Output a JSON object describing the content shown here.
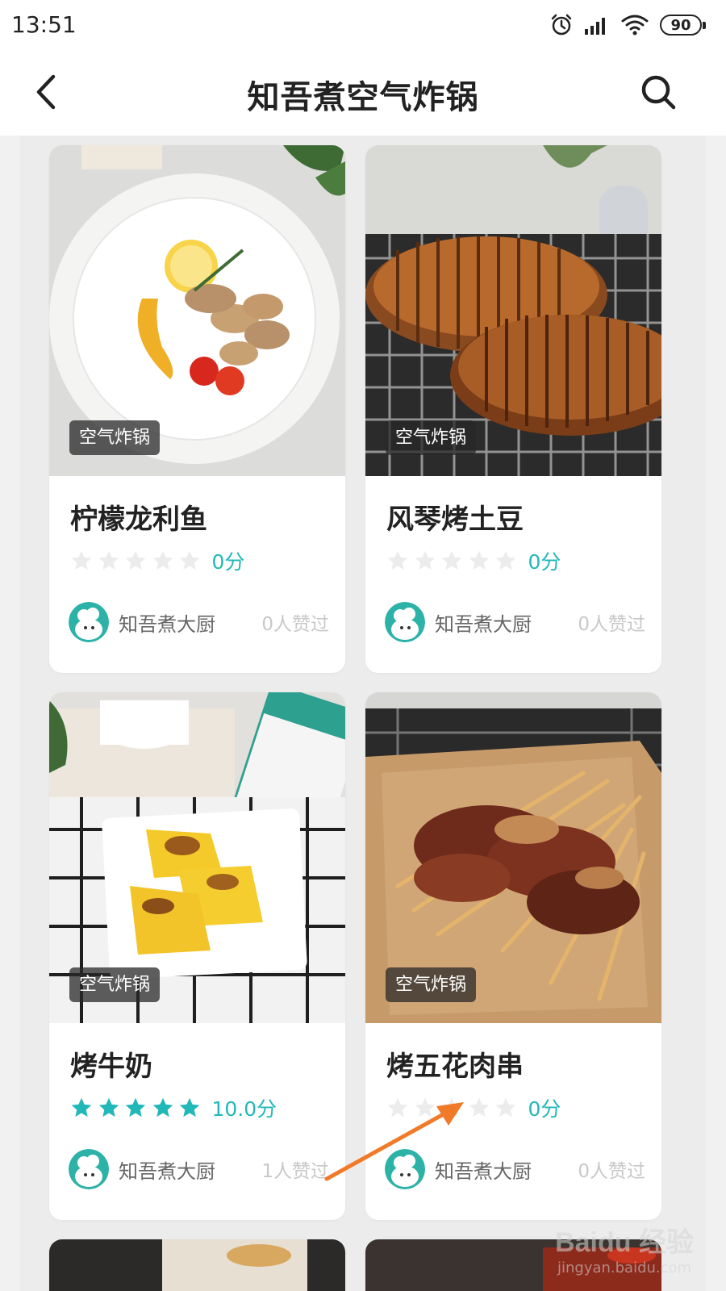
{
  "status_bar": {
    "time": "13:51",
    "battery": "90"
  },
  "header": {
    "title": "知吾煮空气炸锅"
  },
  "colors": {
    "accent": "#22b8b8",
    "star_empty": "#ececec",
    "tag_bg": "#3a3a3a"
  },
  "icons": {
    "back": "chevron-left-icon",
    "search": "search-icon",
    "alarm": "alarm-icon",
    "signal": "signal-icon",
    "wifi": "wifi-icon"
  },
  "cards": [
    {
      "tag": "空气炸锅",
      "title": "柠檬龙利鱼",
      "rating_stars": 0,
      "score": "0分",
      "author": "知吾煮大厨",
      "likes": "0人赞过"
    },
    {
      "tag": "空气炸锅",
      "title": "风琴烤土豆",
      "rating_stars": 0,
      "score": "0分",
      "author": "知吾煮大厨",
      "likes": "0人赞过"
    },
    {
      "tag": "空气炸锅",
      "title": "烤牛奶",
      "rating_stars": 5,
      "score": "10.0分",
      "author": "知吾煮大厨",
      "likes": "1人赞过"
    },
    {
      "tag": "空气炸锅",
      "title": "烤五花肉串",
      "rating_stars": 0,
      "score": "0分",
      "author": "知吾煮大厨",
      "likes": "0人赞过"
    }
  ],
  "watermark": {
    "logo": "Baidu 经验",
    "url": "jingyan.baidu.com"
  }
}
